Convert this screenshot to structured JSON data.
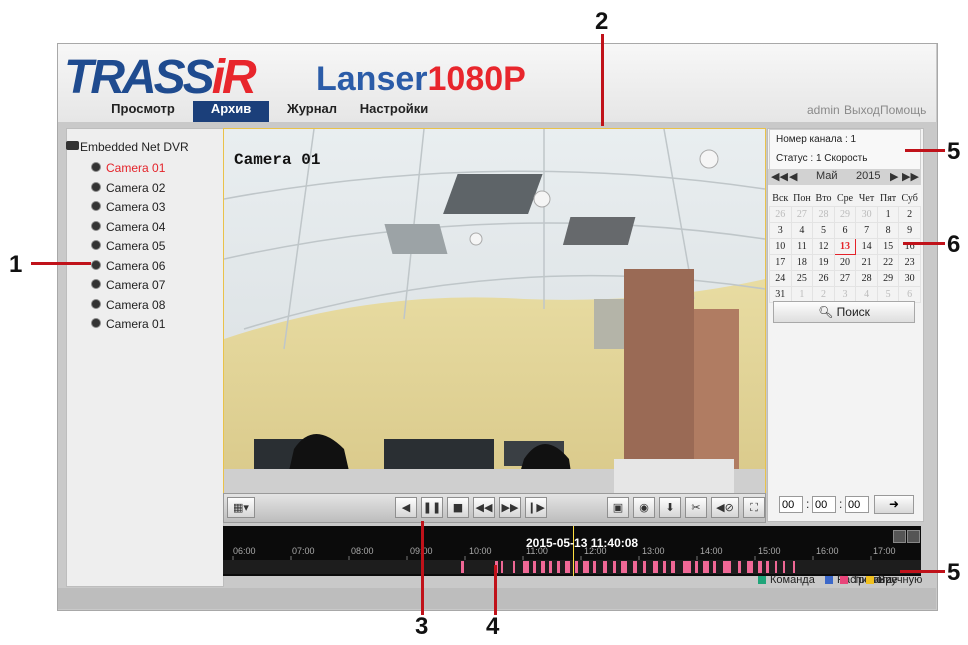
{
  "header": {
    "logo_text_a": "TRASS",
    "logo_text_b": "i",
    "logo_text_c": "R",
    "product_a": "Lanser",
    "product_b": "1080P"
  },
  "nav": {
    "tabs": [
      {
        "label": "Просмотр",
        "active": false
      },
      {
        "label": "Архив",
        "active": true
      },
      {
        "label": "Журнал",
        "active": false
      },
      {
        "label": "Настройки",
        "active": false
      }
    ],
    "user": "admin",
    "logout": "Выход",
    "help": "Помощь"
  },
  "tree": {
    "root": "Embedded Net DVR",
    "cameras": [
      {
        "label": "Camera 01",
        "selected": true
      },
      {
        "label": "Camera 02",
        "selected": false
      },
      {
        "label": "Camera 03",
        "selected": false
      },
      {
        "label": "Camera 04",
        "selected": false
      },
      {
        "label": "Camera 05",
        "selected": false
      },
      {
        "label": "Camera 06",
        "selected": false
      },
      {
        "label": "Camera 07",
        "selected": false
      },
      {
        "label": "Camera 08",
        "selected": false
      },
      {
        "label": "Camera 01",
        "selected": false
      }
    ]
  },
  "video": {
    "osd_label": "Camera 01"
  },
  "toolbar": {
    "icons": [
      "layout-icon",
      "step-back-icon",
      "pause-icon",
      "stop-icon",
      "rewind-icon",
      "fast-forward-icon",
      "frame-forward-icon",
      "clip-icon",
      "snapshot-icon",
      "download-icon",
      "cut-icon",
      "volume-mute-icon",
      "fullscreen-icon"
    ]
  },
  "timeline": {
    "current_time": "2015-05-13 11:40:08",
    "hours": [
      "06:00",
      "07:00",
      "08:00",
      "09:00",
      "10:00",
      "11:00",
      "12:00",
      "13:00",
      "14:00",
      "15:00",
      "16:00",
      "17:00"
    ],
    "legend": [
      {
        "label": "Команда",
        "color": "#1fa57a"
      },
      {
        "label": "Расписание",
        "color": "#3c68c9"
      },
      {
        "label": "Тревога",
        "color": "#e8457a"
      },
      {
        "label": "Вручную",
        "color": "#f0c020"
      }
    ],
    "event_color": "#f06896"
  },
  "info": {
    "channel": "Номер канала : 1",
    "status": "Статус : 1 Скорость"
  },
  "calendar": {
    "month": "Май",
    "year": "2015",
    "nav_prev_year": "◀◀",
    "nav_prev_month": "◀",
    "nav_next_month": "▶",
    "nav_next_year": "▶▶",
    "weekdays": [
      "Вск",
      "Пон",
      "Вто",
      "Сре",
      "Чет",
      "Пят",
      "Суб"
    ],
    "weeks": [
      [
        "26",
        "27",
        "28",
        "29",
        "30",
        "1",
        "2"
      ],
      [
        "3",
        "4",
        "5",
        "6",
        "7",
        "8",
        "9"
      ],
      [
        "10",
        "11",
        "12",
        "13",
        "14",
        "15",
        "16"
      ],
      [
        "17",
        "18",
        "19",
        "20",
        "21",
        "22",
        "23"
      ],
      [
        "24",
        "25",
        "26",
        "27",
        "28",
        "29",
        "30"
      ],
      [
        "31",
        "1",
        "2",
        "3",
        "4",
        "5",
        "6"
      ]
    ],
    "today": "13",
    "search_label": "Поиск"
  },
  "time_jump": {
    "hh": "00",
    "mm": "00",
    "ss": "00"
  },
  "callouts": [
    "1",
    "2",
    "3",
    "4",
    "5",
    "5",
    "6"
  ],
  "colors": {
    "brand_blue": "#1b3f7a",
    "accent_red": "#e4232a",
    "callout_line": "#c0121a"
  }
}
